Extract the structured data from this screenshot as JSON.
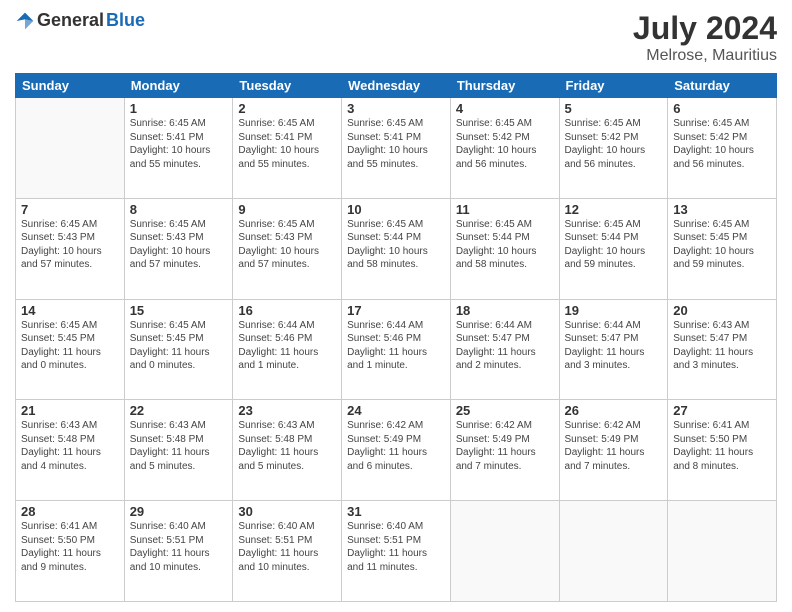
{
  "header": {
    "logo_general": "General",
    "logo_blue": "Blue",
    "month_year": "July 2024",
    "location": "Melrose, Mauritius"
  },
  "weekdays": [
    "Sunday",
    "Monday",
    "Tuesday",
    "Wednesday",
    "Thursday",
    "Friday",
    "Saturday"
  ],
  "weeks": [
    [
      {
        "day": "",
        "info": ""
      },
      {
        "day": "1",
        "info": "Sunrise: 6:45 AM\nSunset: 5:41 PM\nDaylight: 10 hours\nand 55 minutes."
      },
      {
        "day": "2",
        "info": "Sunrise: 6:45 AM\nSunset: 5:41 PM\nDaylight: 10 hours\nand 55 minutes."
      },
      {
        "day": "3",
        "info": "Sunrise: 6:45 AM\nSunset: 5:41 PM\nDaylight: 10 hours\nand 55 minutes."
      },
      {
        "day": "4",
        "info": "Sunrise: 6:45 AM\nSunset: 5:42 PM\nDaylight: 10 hours\nand 56 minutes."
      },
      {
        "day": "5",
        "info": "Sunrise: 6:45 AM\nSunset: 5:42 PM\nDaylight: 10 hours\nand 56 minutes."
      },
      {
        "day": "6",
        "info": "Sunrise: 6:45 AM\nSunset: 5:42 PM\nDaylight: 10 hours\nand 56 minutes."
      }
    ],
    [
      {
        "day": "7",
        "info": "Sunrise: 6:45 AM\nSunset: 5:43 PM\nDaylight: 10 hours\nand 57 minutes."
      },
      {
        "day": "8",
        "info": "Sunrise: 6:45 AM\nSunset: 5:43 PM\nDaylight: 10 hours\nand 57 minutes."
      },
      {
        "day": "9",
        "info": "Sunrise: 6:45 AM\nSunset: 5:43 PM\nDaylight: 10 hours\nand 57 minutes."
      },
      {
        "day": "10",
        "info": "Sunrise: 6:45 AM\nSunset: 5:44 PM\nDaylight: 10 hours\nand 58 minutes."
      },
      {
        "day": "11",
        "info": "Sunrise: 6:45 AM\nSunset: 5:44 PM\nDaylight: 10 hours\nand 58 minutes."
      },
      {
        "day": "12",
        "info": "Sunrise: 6:45 AM\nSunset: 5:44 PM\nDaylight: 10 hours\nand 59 minutes."
      },
      {
        "day": "13",
        "info": "Sunrise: 6:45 AM\nSunset: 5:45 PM\nDaylight: 10 hours\nand 59 minutes."
      }
    ],
    [
      {
        "day": "14",
        "info": "Sunrise: 6:45 AM\nSunset: 5:45 PM\nDaylight: 11 hours\nand 0 minutes."
      },
      {
        "day": "15",
        "info": "Sunrise: 6:45 AM\nSunset: 5:45 PM\nDaylight: 11 hours\nand 0 minutes."
      },
      {
        "day": "16",
        "info": "Sunrise: 6:44 AM\nSunset: 5:46 PM\nDaylight: 11 hours\nand 1 minute."
      },
      {
        "day": "17",
        "info": "Sunrise: 6:44 AM\nSunset: 5:46 PM\nDaylight: 11 hours\nand 1 minute."
      },
      {
        "day": "18",
        "info": "Sunrise: 6:44 AM\nSunset: 5:47 PM\nDaylight: 11 hours\nand 2 minutes."
      },
      {
        "day": "19",
        "info": "Sunrise: 6:44 AM\nSunset: 5:47 PM\nDaylight: 11 hours\nand 3 minutes."
      },
      {
        "day": "20",
        "info": "Sunrise: 6:43 AM\nSunset: 5:47 PM\nDaylight: 11 hours\nand 3 minutes."
      }
    ],
    [
      {
        "day": "21",
        "info": "Sunrise: 6:43 AM\nSunset: 5:48 PM\nDaylight: 11 hours\nand 4 minutes."
      },
      {
        "day": "22",
        "info": "Sunrise: 6:43 AM\nSunset: 5:48 PM\nDaylight: 11 hours\nand 5 minutes."
      },
      {
        "day": "23",
        "info": "Sunrise: 6:43 AM\nSunset: 5:48 PM\nDaylight: 11 hours\nand 5 minutes."
      },
      {
        "day": "24",
        "info": "Sunrise: 6:42 AM\nSunset: 5:49 PM\nDaylight: 11 hours\nand 6 minutes."
      },
      {
        "day": "25",
        "info": "Sunrise: 6:42 AM\nSunset: 5:49 PM\nDaylight: 11 hours\nand 7 minutes."
      },
      {
        "day": "26",
        "info": "Sunrise: 6:42 AM\nSunset: 5:49 PM\nDaylight: 11 hours\nand 7 minutes."
      },
      {
        "day": "27",
        "info": "Sunrise: 6:41 AM\nSunset: 5:50 PM\nDaylight: 11 hours\nand 8 minutes."
      }
    ],
    [
      {
        "day": "28",
        "info": "Sunrise: 6:41 AM\nSunset: 5:50 PM\nDaylight: 11 hours\nand 9 minutes."
      },
      {
        "day": "29",
        "info": "Sunrise: 6:40 AM\nSunset: 5:51 PM\nDaylight: 11 hours\nand 10 minutes."
      },
      {
        "day": "30",
        "info": "Sunrise: 6:40 AM\nSunset: 5:51 PM\nDaylight: 11 hours\nand 10 minutes."
      },
      {
        "day": "31",
        "info": "Sunrise: 6:40 AM\nSunset: 5:51 PM\nDaylight: 11 hours\nand 11 minutes."
      },
      {
        "day": "",
        "info": ""
      },
      {
        "day": "",
        "info": ""
      },
      {
        "day": "",
        "info": ""
      }
    ]
  ]
}
